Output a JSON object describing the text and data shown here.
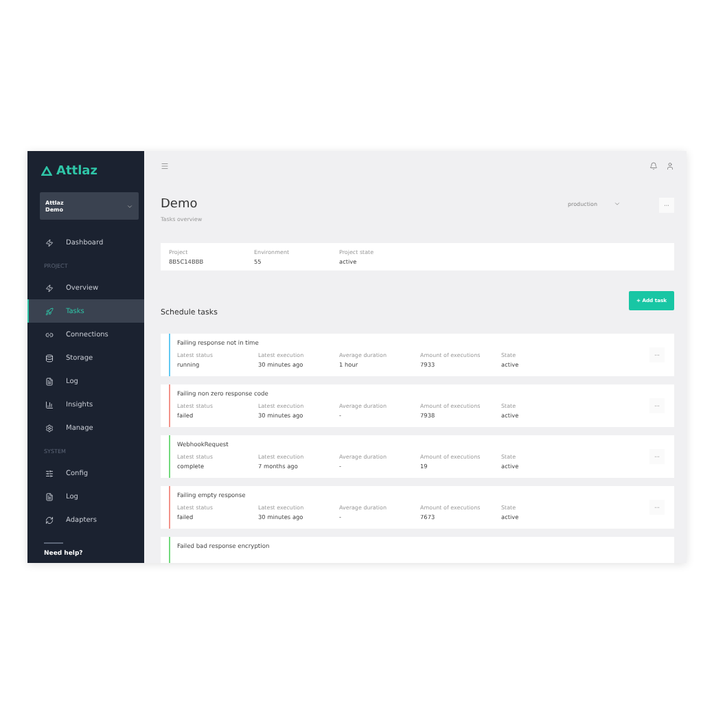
{
  "sidebar": {
    "logo": "Attlaz",
    "project_selector": {
      "line_1": "Attlaz",
      "line_2": "Demo"
    },
    "nav": [
      {
        "kind": "item",
        "label": "Dashboard",
        "selected": false
      },
      {
        "kind": "header",
        "label": "PROJECT"
      },
      {
        "kind": "item",
        "label": "Overview",
        "selected": false
      },
      {
        "kind": "item",
        "label": "Tasks",
        "selected": true
      },
      {
        "kind": "item",
        "label": "Connections",
        "selected": false
      },
      {
        "kind": "item",
        "label": "Storage",
        "selected": false
      },
      {
        "kind": "item",
        "label": "Log",
        "selected": false
      },
      {
        "kind": "item",
        "label": "Insights",
        "selected": false
      },
      {
        "kind": "item",
        "label": "Manage",
        "selected": false
      },
      {
        "kind": "header",
        "label": "SYSTEM"
      },
      {
        "kind": "item",
        "label": "Config",
        "selected": false
      },
      {
        "kind": "item",
        "label": "Log",
        "selected": false
      },
      {
        "kind": "item",
        "label": "Adapters",
        "selected": false
      }
    ],
    "help": "Need help?"
  },
  "header": {
    "title": "Demo",
    "subtitle": "Tasks overview",
    "environment_select": "production",
    "more_button": "···"
  },
  "info": [
    {
      "label": "Project",
      "value": "8B5C14BBB"
    },
    {
      "label": "Environment",
      "value": "55"
    },
    {
      "label": "Project state",
      "value": "active"
    }
  ],
  "add_task": "+ Add task",
  "section_title": "Schedule tasks",
  "tasks": [
    {
      "title": "Failing response not in time",
      "color": "#62c9f2",
      "more": "···",
      "fields": [
        {
          "label": "Latest status",
          "value": "running"
        },
        {
          "label": "Latest execution",
          "value": "30 minutes ago"
        },
        {
          "label": "Average duration",
          "value": "1 hour"
        },
        {
          "label": "Amount of executions",
          "value": "7933"
        },
        {
          "label": "State",
          "value": "active"
        }
      ]
    },
    {
      "title": "Failing non zero response code",
      "color": "#f2938a",
      "more": "···",
      "fields": [
        {
          "label": "Latest status",
          "value": "failed"
        },
        {
          "label": "Latest execution",
          "value": "30 minutes ago"
        },
        {
          "label": "Average duration",
          "value": "-"
        },
        {
          "label": "Amount of executions",
          "value": "7938"
        },
        {
          "label": "State",
          "value": "active"
        }
      ]
    },
    {
      "title": "WebhookRequest",
      "color": "#72d97c",
      "more": "···",
      "fields": [
        {
          "label": "Latest status",
          "value": "complete"
        },
        {
          "label": "Latest execution",
          "value": "7 months ago"
        },
        {
          "label": "Average duration",
          "value": "-"
        },
        {
          "label": "Amount of executions",
          "value": "19"
        },
        {
          "label": "State",
          "value": "active"
        }
      ]
    },
    {
      "title": "Failing empty response",
      "color": "#f2938a",
      "more": "···",
      "fields": [
        {
          "label": "Latest status",
          "value": "failed"
        },
        {
          "label": "Latest execution",
          "value": "30 minutes ago"
        },
        {
          "label": "Average duration",
          "value": "-"
        },
        {
          "label": "Amount of executions",
          "value": "7673"
        },
        {
          "label": "State",
          "value": "active"
        }
      ]
    },
    {
      "title": "Failed bad response encryption",
      "color": "#72d97c"
    }
  ]
}
